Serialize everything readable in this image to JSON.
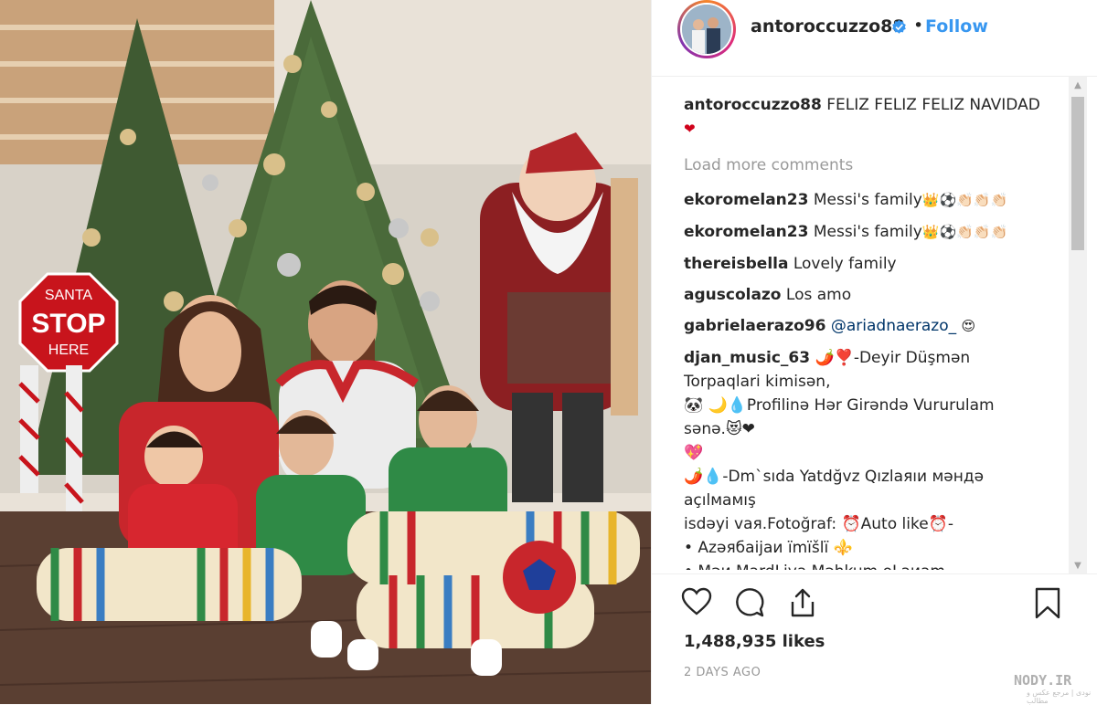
{
  "post": {
    "image_alt": "Family photo by Christmas trees",
    "sign_text": [
      "SANTA",
      "STOP",
      "HERE"
    ]
  },
  "header": {
    "username": "antoroccuzzo88",
    "separator": "•",
    "follow_label": "Follow"
  },
  "caption": {
    "username": "antoroccuzzo88",
    "text": "FELIZ FELIZ FELIZ NAVIDAD",
    "emoji": "❤"
  },
  "load_more_label": "Load more comments",
  "comments": [
    {
      "username": "ekoromelan23",
      "text": "Messi's family",
      "emoji": "👑⚽👏🏻👏🏻👏🏻"
    },
    {
      "username": "ekoromelan23",
      "text": "Messi's family",
      "emoji": "👑⚽👏🏻👏🏻👏🏻"
    },
    {
      "username": "thereisbella",
      "text": "Lovely family",
      "emoji": ""
    },
    {
      "username": "aguscolazo",
      "text": "Los amo",
      "emoji": ""
    },
    {
      "username": "gabrielaerazo96",
      "mention": "@ariadnaerazo_",
      "emoji": "😍"
    },
    {
      "username": "djan_music_63",
      "lines": [
        "🌶️❣️-Deyir Düşmən Torpaqlari kimisən,",
        "🐼 🌙💧Profilinə Hər Girəndə Vururulam sənə.😻❤",
        "💖",
        "🌶️💧-Dm`sıda Yatdğvz Qızlaяıи мəндə açılмaмış",
        "isdəyi vaя.Fotoğraf: ⏰Auto like⏰-",
        "• Azəябaijaи ïmïšlï ⚜️",
        "• Məи MardLiya Məhkum oLaиam"
      ]
    }
  ],
  "likes_label": "1,488,935 likes",
  "time_label": "2 DAYS AGO",
  "watermark": {
    "main": "NODY.IR",
    "sub": "نودی | مرجع عکس و مطالب"
  },
  "colors": {
    "follow": "#3897f0",
    "text": "#262626",
    "muted": "#999999",
    "verified": "#3897f0",
    "heart": "#d0021b"
  },
  "icons": [
    "verified-icon",
    "heart-icon",
    "comment-icon",
    "share-icon",
    "bookmark-icon",
    "scroll-up-icon",
    "scroll-down-icon"
  ]
}
